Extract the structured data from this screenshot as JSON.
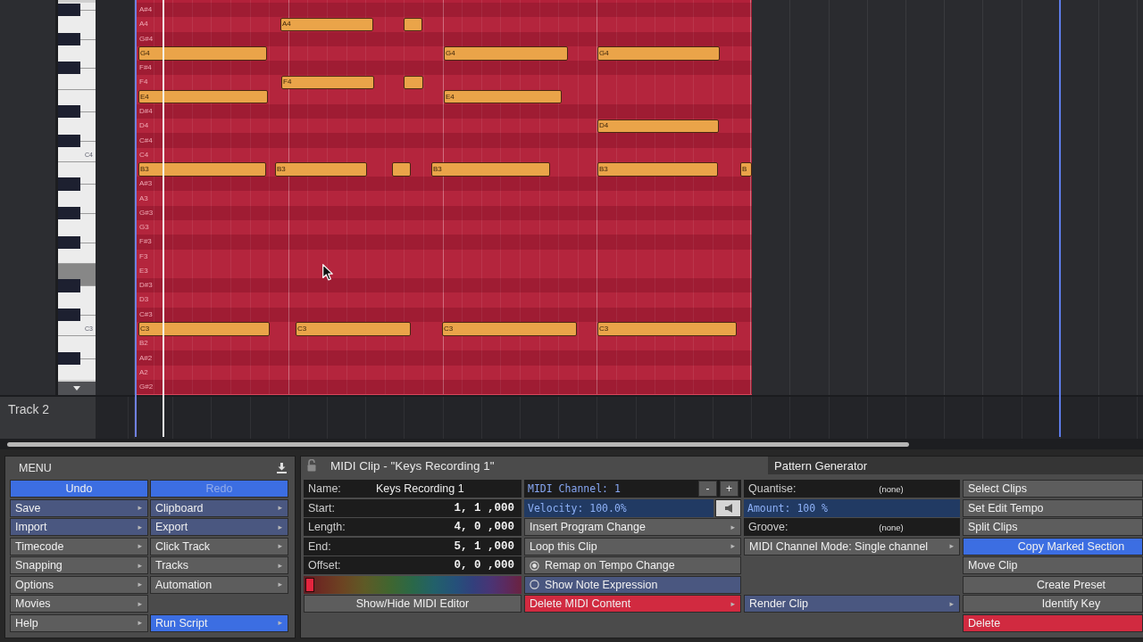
{
  "keyboard": {
    "keys": [
      {
        "black": true,
        "highlighted": false
      },
      {
        "black": false,
        "highlighted": false
      },
      {
        "black": true,
        "highlighted": false
      },
      {
        "black": false,
        "highlighted": false
      },
      {
        "black": true,
        "highlighted": false
      },
      {
        "black": false,
        "highlighted": false
      },
      {
        "black": false,
        "highlighted": false
      },
      {
        "black": true,
        "highlighted": false
      },
      {
        "black": false,
        "highlighted": false
      },
      {
        "black": true,
        "highlighted": false
      },
      {
        "black": false,
        "highlighted": false,
        "label": "C4"
      },
      {
        "black": false,
        "highlighted": false
      },
      {
        "black": true,
        "highlighted": false
      },
      {
        "black": false,
        "highlighted": false
      },
      {
        "black": true,
        "highlighted": false
      },
      {
        "black": false,
        "highlighted": false
      },
      {
        "black": true,
        "highlighted": false
      },
      {
        "black": false,
        "highlighted": false
      },
      {
        "black": false,
        "highlighted": true
      },
      {
        "black": true,
        "highlighted": false
      },
      {
        "black": false,
        "highlighted": false
      },
      {
        "black": true,
        "highlighted": false
      },
      {
        "black": false,
        "highlighted": false,
        "label": "C3"
      },
      {
        "black": false,
        "highlighted": false
      },
      {
        "black": true,
        "highlighted": false
      },
      {
        "black": false,
        "highlighted": false
      }
    ]
  },
  "editor": {
    "rows": [
      {
        "label": "A#4",
        "black_key": true
      },
      {
        "label": "A4",
        "black_key": false,
        "notes": [
          {
            "label": "A4",
            "selected": false
          },
          {
            "selected": false
          }
        ]
      },
      {
        "label": "G#4",
        "black_key": true
      },
      {
        "black_key": false,
        "notes": [
          {
            "label": "G4",
            "selected": false
          },
          {
            "label": "G4",
            "selected": false
          },
          {
            "label": "G4",
            "selected": false
          }
        ]
      },
      {
        "label": "F#4",
        "black_key": true
      },
      {
        "label": "F4",
        "black_key": false,
        "notes": [
          {
            "label": "F4",
            "selected": false
          },
          {
            "selected": false
          }
        ]
      },
      {
        "black_key": false,
        "notes": [
          {
            "label": "E4",
            "selected": false
          },
          {
            "label": "E4",
            "selected": false
          }
        ]
      },
      {
        "label": "D#4",
        "black_key": true
      },
      {
        "label": "D4",
        "black_key": false,
        "notes": [
          {
            "label": "D4",
            "selected": false
          }
        ]
      },
      {
        "label": "C#4",
        "black_key": true
      },
      {
        "label": "C4",
        "black_key": false
      },
      {
        "black_key": false,
        "notes": [
          {
            "label": "B3",
            "selected": false
          },
          {
            "label": "B3",
            "selected": false
          },
          {
            "selected": false
          },
          {
            "label": "B3",
            "selected": false
          },
          {
            "label": "B3",
            "selected": false
          },
          {
            "label": "B",
            "selected": false
          }
        ]
      },
      {
        "label": "A#3",
        "black_key": true
      },
      {
        "label": "A3",
        "black_key": false
      },
      {
        "label": "G#3",
        "black_key": true
      },
      {
        "label": "G3",
        "black_key": false
      },
      {
        "label": "F#3",
        "black_key": true
      },
      {
        "label": "F3",
        "black_key": false
      },
      {
        "label": "E3",
        "black_key": false
      },
      {
        "label": "D#3",
        "black_key": true
      },
      {
        "label": "D3",
        "black_key": false
      },
      {
        "label": "C#3",
        "black_key": true
      },
      {
        "black_key": false,
        "notes": [
          {
            "label": "C3",
            "selected": false
          },
          {
            "label": "C3",
            "selected": false
          },
          {
            "label": "C3",
            "selected": false
          },
          {
            "label": "C3",
            "selected": false
          }
        ]
      },
      {
        "label": "B2",
        "black_key": false
      },
      {
        "label": "A#2",
        "black_key": true
      },
      {
        "label": "A2",
        "black_key": false
      },
      {
        "label": "G#2",
        "black_key": true
      }
    ]
  },
  "track": {
    "name": "Track 2"
  },
  "menu": {
    "title": "MENU",
    "columns": [
      {
        "items": [
          {
            "label": "Undo",
            "kind": "command",
            "color": "#3c6ee2",
            "disabled": false
          },
          {
            "label": "Save",
            "kind": "menu",
            "color": "#4a5780",
            "arrow": "▸",
            "disabled": false
          },
          {
            "label": "Import",
            "kind": "menu",
            "color": "#4a5780",
            "arrow": "▸",
            "disabled": false
          },
          {
            "label": "Timecode",
            "kind": "menu",
            "color": "#5d5d5d",
            "arrow": "▸",
            "disabled": false
          },
          {
            "label": "Snapping",
            "kind": "menu",
            "color": "#5d5d5d",
            "arrow": "▸",
            "disabled": false
          },
          {
            "label": "Options",
            "kind": "menu",
            "color": "#5d5d5d",
            "arrow": "▸",
            "disabled": false
          },
          {
            "label": "Movies",
            "kind": "menu",
            "color": "#5d5d5d",
            "arrow": "▸",
            "disabled": false
          },
          {
            "label": "Help",
            "kind": "menu",
            "color": "#5d5d5d",
            "arrow": "▸",
            "disabled": false
          }
        ]
      },
      {
        "items": [
          {
            "label": "Redo",
            "kind": "command",
            "color": "#3c6ee2",
            "disabled": true
          },
          {
            "label": "Clipboard",
            "kind": "menu",
            "color": "#4a5780",
            "arrow": "▸",
            "disabled": false
          },
          {
            "label": "Export",
            "kind": "menu",
            "color": "#4a5780",
            "arrow": "▸",
            "disabled": false
          },
          {
            "label": "Click Track",
            "kind": "menu",
            "color": "#5d5d5d",
            "arrow": "▸",
            "disabled": false
          },
          {
            "label": "Tracks",
            "kind": "menu",
            "color": "#5d5d5d",
            "arrow": "▸",
            "disabled": false
          },
          {
            "label": "Automation",
            "kind": "menu",
            "color": "#5d5d5d",
            "arrow": "▸",
            "disabled": false
          },
          {
            "label": "Run Script",
            "kind": "menu",
            "color": "#3c6ee2",
            "arrow": "▸",
            "disabled": false
          }
        ]
      }
    ]
  },
  "clip_panel": {
    "title": "MIDI Clip - \"Keys Recording 1\"",
    "locked": false,
    "tab": {
      "label": "Pattern Generator",
      "selected": false
    },
    "fields": [
      {
        "label": "Name:",
        "value": "Keys Recording 1",
        "kind": "text"
      },
      {
        "label": "Start:",
        "value": "1, 1 ,000",
        "kind": "time"
      },
      {
        "label": "Length:",
        "value": "4, 0 ,000",
        "kind": "time"
      },
      {
        "label": "End:",
        "value": "5, 1 ,000",
        "kind": "time"
      },
      {
        "label": "Offset:",
        "value": "0, 0 ,000",
        "kind": "time"
      }
    ],
    "color": "#e4253e",
    "editor_button": {
      "label": "Show/Hide MIDI Editor",
      "kind": "command",
      "color": "#5d5d5d"
    },
    "midi_channel": {
      "reading": "MIDI Channel: 1",
      "buttons": [
        "-",
        "+"
      ]
    },
    "velocity": {
      "reading": "Velocity: 100.0%",
      "level": 1
    },
    "actions": [
      {
        "label": "Insert Program Change",
        "kind": "menu",
        "color": "#5d5d5d",
        "arrow": "▸"
      },
      {
        "label": "Loop this Clip",
        "kind": "menu",
        "color": "#5d5d5d",
        "arrow": "▸"
      },
      {
        "label": "Remap on Tempo Change",
        "kind": "radio",
        "color": "#5d5d5d",
        "checked": true
      },
      {
        "label": "Show Note Expression",
        "kind": "radio",
        "color": "#4a5780",
        "checked": false
      },
      {
        "label": "Delete MIDI Content",
        "kind": "menu",
        "color": "#d12a40",
        "arrow": "▸"
      }
    ],
    "quantise": {
      "label": "Quantise:",
      "value": "(none)"
    },
    "amount": {
      "reading": "Amount: 100 %",
      "level": 1
    },
    "groove": {
      "label": "Groove:",
      "value": "(none)"
    },
    "mode": {
      "label": "MIDI Channel Mode: Single channel",
      "kind": "menu",
      "color": "#5d5d5d",
      "arrow": "▸"
    },
    "render": {
      "label": "Render Clip",
      "kind": "menu",
      "color": "#4a5780",
      "arrow": "▸"
    },
    "clip_actions": [
      {
        "label": "Select Clips",
        "kind": "menu",
        "color": "#5d5d5d"
      },
      {
        "label": "Set Edit Tempo",
        "kind": "menu",
        "color": "#5d5d5d"
      },
      {
        "label": "Split Clips",
        "kind": "menu",
        "color": "#5d5d5d"
      },
      {
        "label": "Copy Marked Section",
        "kind": "command",
        "color": "#3c6ee2"
      },
      {
        "label": "Move Clip",
        "kind": "menu",
        "color": "#5d5d5d"
      },
      {
        "label": "Create Preset",
        "kind": "command",
        "color": "#5d5d5d"
      },
      {
        "label": "Identify Key",
        "kind": "command",
        "color": "#5d5d5d"
      },
      {
        "label": "Delete",
        "kind": "menu",
        "color": "#d12a40"
      }
    ]
  }
}
